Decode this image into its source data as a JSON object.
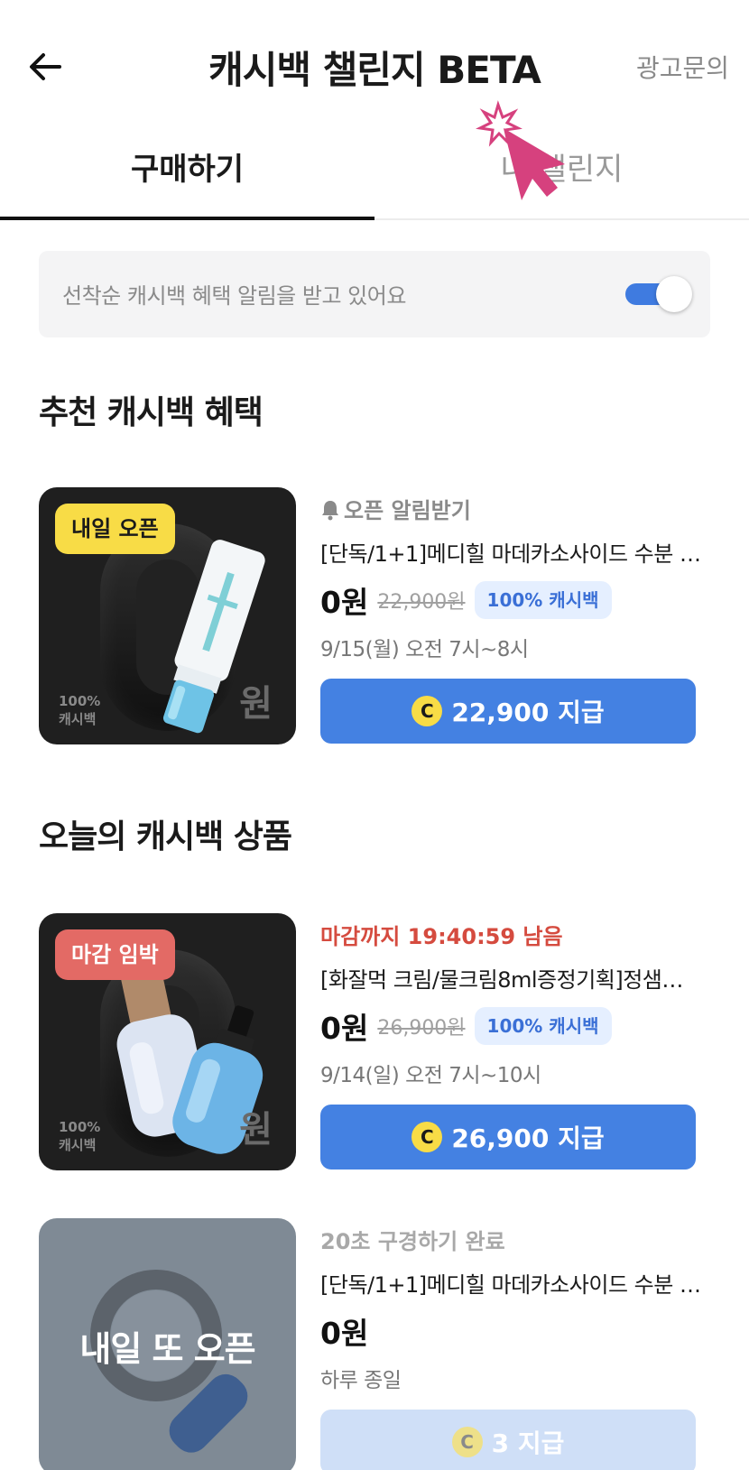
{
  "header": {
    "title": "캐시백 챌린지 BETA",
    "ad_link": "광고문의"
  },
  "tabs": [
    {
      "label": "구매하기",
      "active": true
    },
    {
      "label": "내 챌린지",
      "active": false
    }
  ],
  "notice": {
    "text": "선착순 캐시백 혜택 알림을 받고 있어요",
    "toggle_on": true
  },
  "sections": {
    "recommended_title": "추천 캐시백 혜택",
    "today_title": "오늘의 캐시백 상품"
  },
  "colors": {
    "accent": "#4481e2",
    "toggle": "#3f7be0",
    "badge_yellow": "#f8dc46",
    "badge_red": "#e36a65",
    "deadline_red": "#d54b3f",
    "cashback_tag_bg": "#e5efff"
  },
  "products": [
    {
      "badge": "내일 오픈",
      "thumb_pct": "100%",
      "thumb_cashback": "캐시백",
      "thumb_won": "원",
      "meta_icon": "bell-icon",
      "meta": "오픈 알림받기",
      "name": "[단독/1+1]메디힐 마데카소사이드 수분 …",
      "price": "0원",
      "original_price": "22,900원",
      "cashback_tag": "100% 캐시백",
      "date": "9/15(월) 오전 7시~8시",
      "coin_label": "C",
      "cta": "22,900 지급"
    },
    {
      "badge": "마감 임박",
      "thumb_pct": "100%",
      "thumb_cashback": "캐시백",
      "thumb_won": "원",
      "meta": "마감까지 19:40:59 남음",
      "name": "[화잘먹 크림/물크림8ml증정기획]정샘…",
      "price": "0원",
      "original_price": "26,900원",
      "cashback_tag": "100% 캐시백",
      "date": "9/14(일) 오전 7시~10시",
      "coin_label": "C",
      "cta": "26,900 지급"
    },
    {
      "overlay": "내일 또 오픈",
      "meta": "20초 구경하기 완료",
      "name": "[단독/1+1]메디힐 마데카소사이드 수분 …",
      "price": "0원",
      "date": "하루 종일",
      "coin_label": "C",
      "cta": "3 지급"
    }
  ]
}
